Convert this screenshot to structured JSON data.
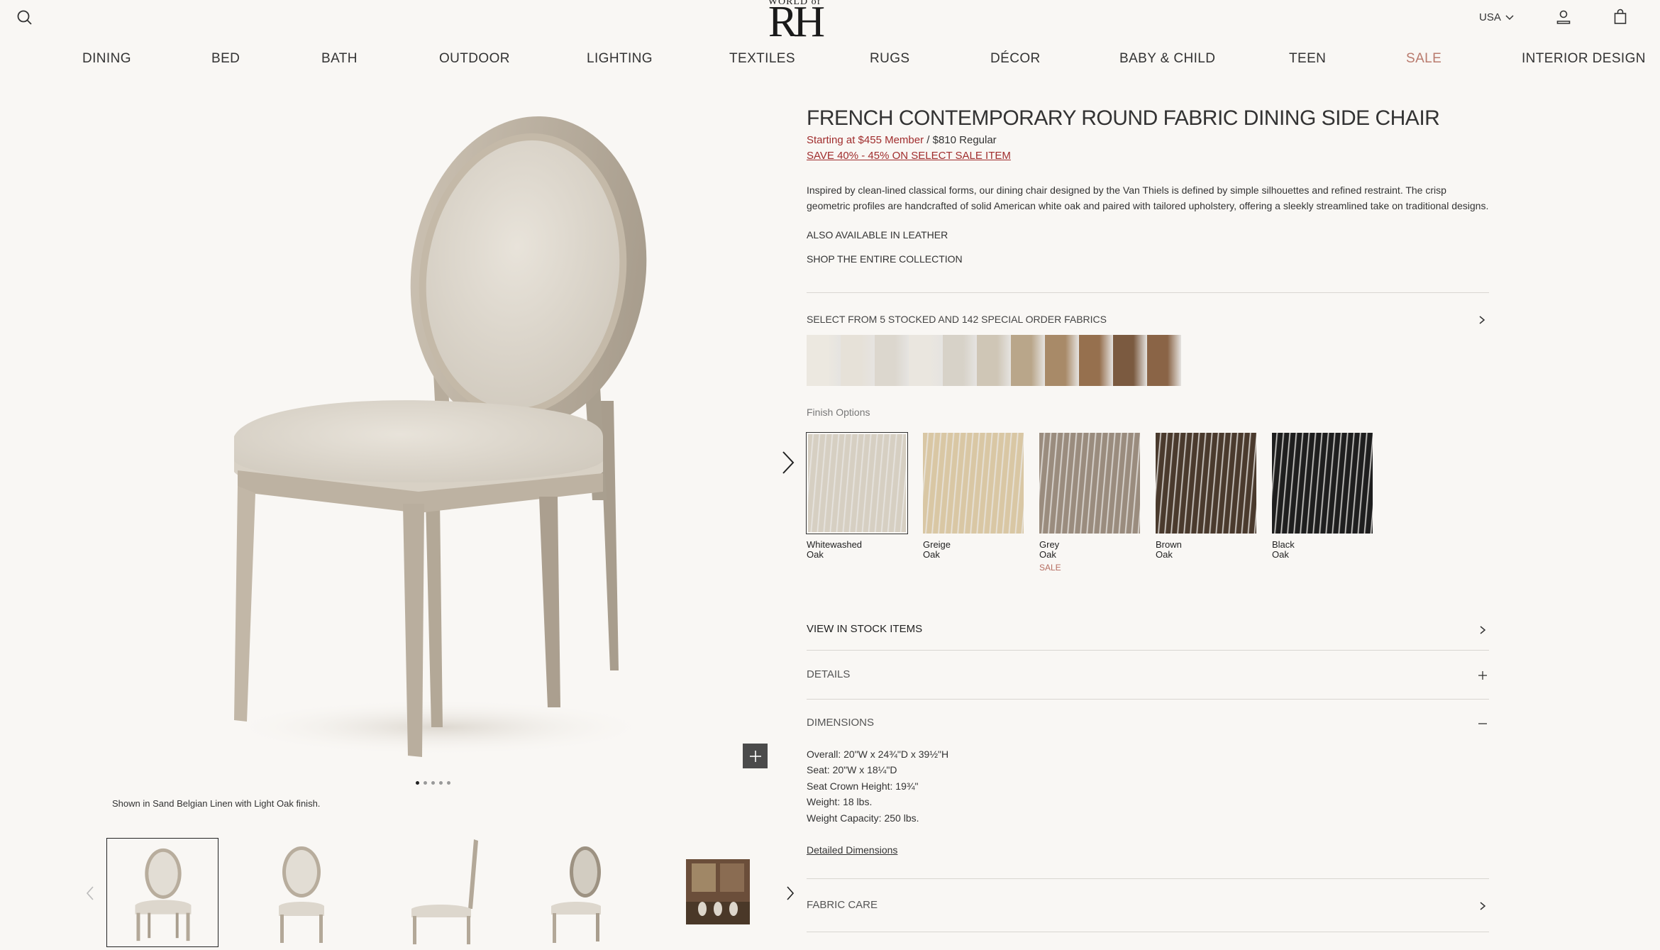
{
  "header": {
    "logo_text": "RH",
    "logo_subtext": "WORLD of",
    "country": "USA"
  },
  "nav": {
    "items": [
      "DINING",
      "BED",
      "BATH",
      "OUTDOOR",
      "LIGHTING",
      "TEXTILES",
      "RUGS",
      "DÉCOR",
      "BABY & CHILD",
      "TEEN",
      "SALE",
      "INTERIOR DESIGN"
    ]
  },
  "gallery": {
    "caption": "Shown in Sand Belgian Linen with Light Oak finish.",
    "dot_count": 5,
    "active_dot": 0
  },
  "product": {
    "title": "FRENCH CONTEMPORARY ROUND FABRIC DINING SIDE CHAIR",
    "price_member": "Starting at $455 Member",
    "price_separator": " / ",
    "price_regular": "$810 Regular",
    "sale_link": "SAVE 40% - 45% ON SELECT SALE ITEM",
    "description": "Inspired by clean-lined classical forms, our dining chair designed by the Van Thiels is defined by simple silhouettes and refined restraint. The crisp geometric profiles are handcrafted of solid American white oak and paired with tailored upholstery, offering a sleekly streamlined take on traditional designs.",
    "also_available": "ALSO AVAILABLE IN LEATHER",
    "shop_collection": "SHOP THE ENTIRE COLLECTION"
  },
  "fabrics": {
    "header": "SELECT FROM 5 STOCKED AND 142 SPECIAL ORDER FABRICS",
    "swatch_colors": [
      "#ece8e0",
      "#e6e1d8",
      "#dcd7ce",
      "#eae6df",
      "#d7d2c8",
      "#cfc6b6",
      "#b9a68a",
      "#a88a68",
      "#96704e",
      "#7b5a40",
      "#8a6446"
    ]
  },
  "finishes": {
    "label": "Finish Options",
    "options": [
      {
        "name": "Whitewashed\nOak",
        "color": "#d6cfc2",
        "badge": ""
      },
      {
        "name": "Greige\nOak",
        "color": "#d9c7a4",
        "badge": ""
      },
      {
        "name": "Grey\nOak",
        "color": "#9a8c7e",
        "badge": "SALE"
      },
      {
        "name": "Brown\nOak",
        "color": "#4a3a2d",
        "badge": ""
      },
      {
        "name": "Black\nOak",
        "color": "#1e1e1e",
        "badge": ""
      }
    ],
    "selected_index": 0
  },
  "accordions": {
    "in_stock": "VIEW IN STOCK ITEMS",
    "details": "DETAILS",
    "dimensions": "DIMENSIONS",
    "fabric_care": "FABRIC CARE"
  },
  "dimensions": {
    "lines": [
      "Overall: 20\"W x 24¾\"D x 39½\"H",
      "Seat: 20\"W x 18¼\"D",
      "Seat Crown Height: 19¾\"",
      "Weight: 18 lbs.",
      "Weight Capacity: 250 lbs."
    ],
    "detailed_link": "Detailed Dimensions"
  }
}
